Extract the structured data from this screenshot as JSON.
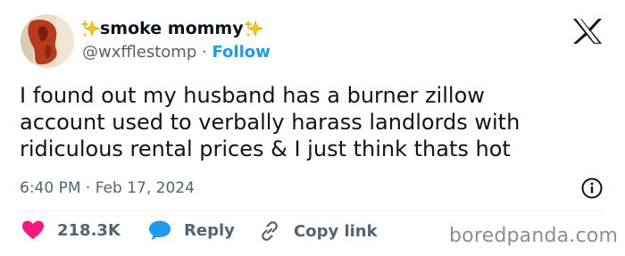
{
  "author": {
    "display_name": "smoke mommy",
    "handle": "@wxfflestomp",
    "separator": "·",
    "follow_label": "Follow"
  },
  "tweet": {
    "text": "I found out my husband has a burner zillow\naccount used to verbally harass landlords with\nridiculous rental prices & I just think thats hot",
    "timestamp": "6:40 PM · Feb 17, 2024"
  },
  "actions": {
    "like_count": "218.3K",
    "reply_label": "Reply",
    "copy_link_label": "Copy link"
  },
  "watermark": "boredpanda.com",
  "icons": {
    "avatar": "avatar-image",
    "name_decoration": "sparkles-icon",
    "platform": "x-logo-icon",
    "info": "info-icon",
    "like": "heart-icon",
    "reply": "speech-bubble-icon",
    "copy": "link-icon"
  },
  "colors": {
    "follow": "#1d9bf0",
    "secondary_text": "#536471",
    "heart": "#f91880",
    "reply_bubble": "#1d9bf0",
    "sparkle": "#f5c71a"
  }
}
